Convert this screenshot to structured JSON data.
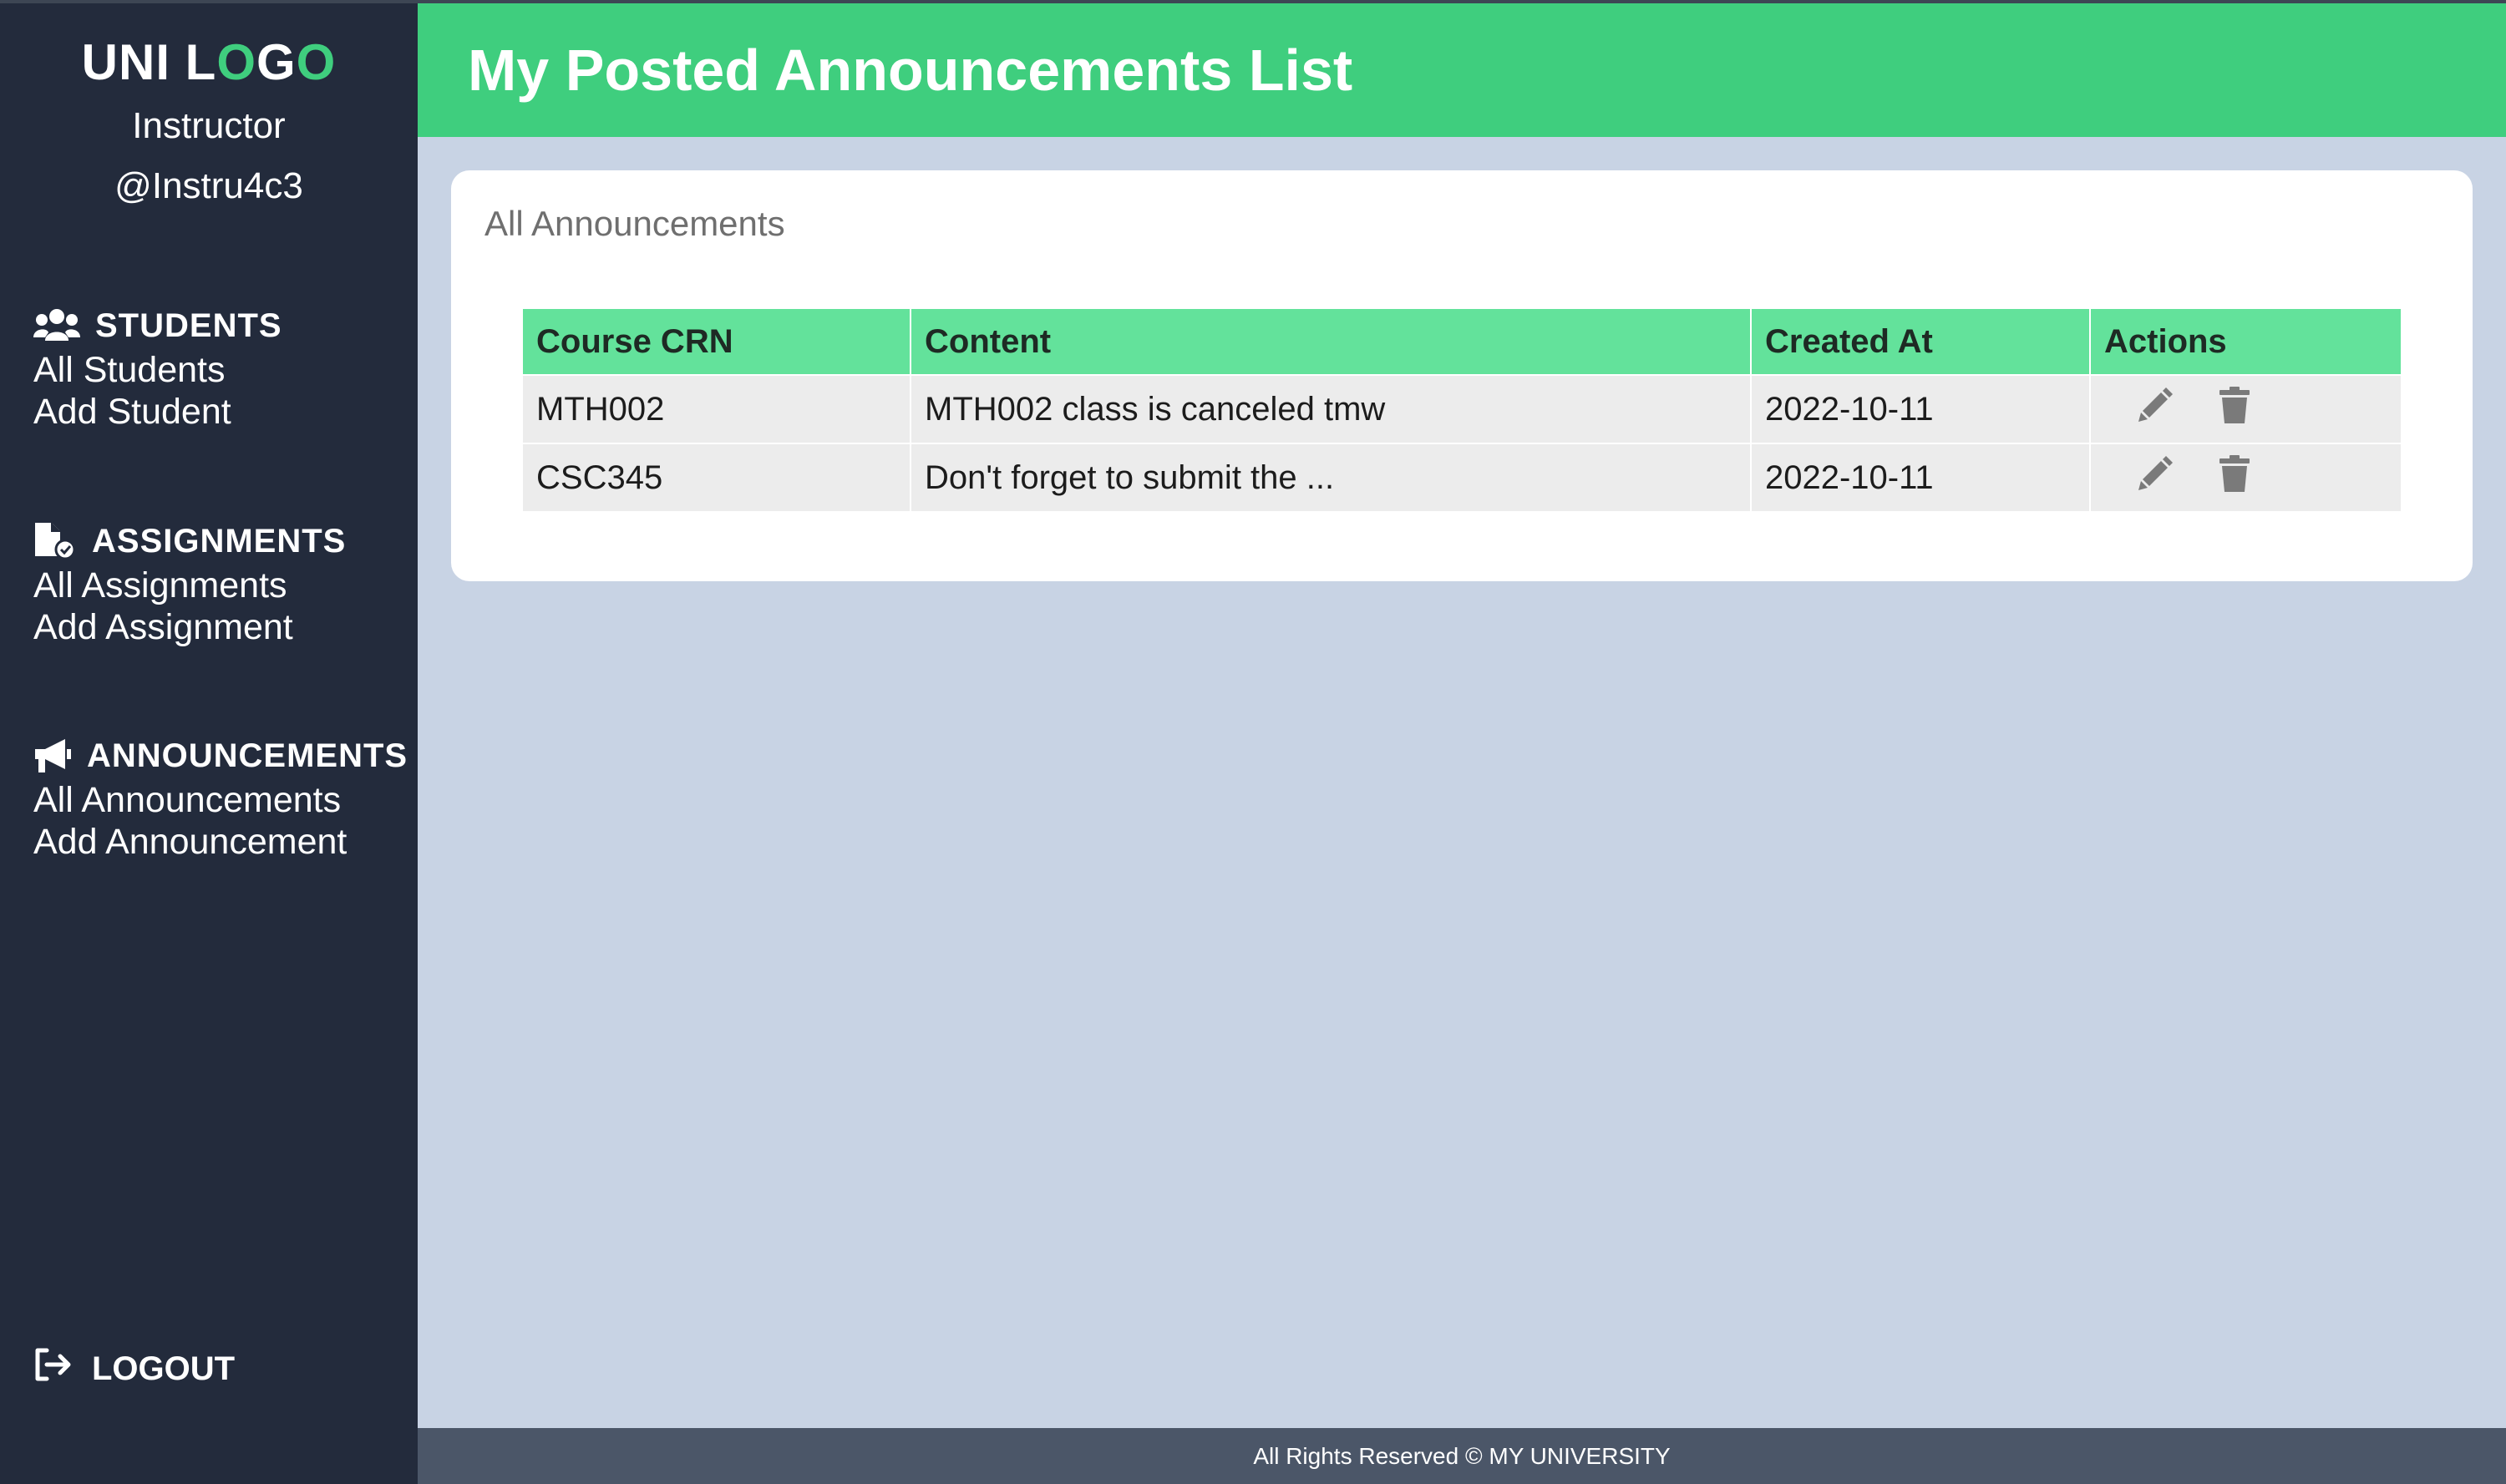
{
  "brand": {
    "logo_a": "UNI L",
    "logo_b": "O",
    "logo_c": "G",
    "logo_d": "O"
  },
  "user": {
    "role": "Instructor",
    "handle": "@Instru4c3"
  },
  "sidebar": {
    "students": {
      "title": "STUDENTS",
      "links": [
        "All Students",
        "Add Student"
      ]
    },
    "assignments": {
      "title": "ASSIGNMENTS",
      "links": [
        "All Assignments",
        "Add Assignment"
      ]
    },
    "announcements": {
      "title": "ANNOUNCEMENTS",
      "links": [
        "All Announcements",
        "Add Announcement"
      ]
    },
    "logout": "LOGOUT"
  },
  "header": {
    "title": "My Posted Announcements List"
  },
  "card": {
    "title": "All Announcements"
  },
  "table": {
    "columns": [
      "Course CRN",
      "Content",
      "Created At",
      "Actions"
    ],
    "rows": [
      {
        "crn": "MTH002",
        "content": "MTH002 class is canceled tmw",
        "created": "2022-10-11"
      },
      {
        "crn": "CSC345",
        "content": "Don't forget to submit the ...",
        "created": "2022-10-11"
      }
    ]
  },
  "footer": {
    "text": "All Rights Reserved © MY UNIVERSITY"
  },
  "colors": {
    "accent": "#3fce7e",
    "sidebar": "#232b3c",
    "table_header": "#63e29b",
    "icon_gray": "#7a7a7a"
  }
}
